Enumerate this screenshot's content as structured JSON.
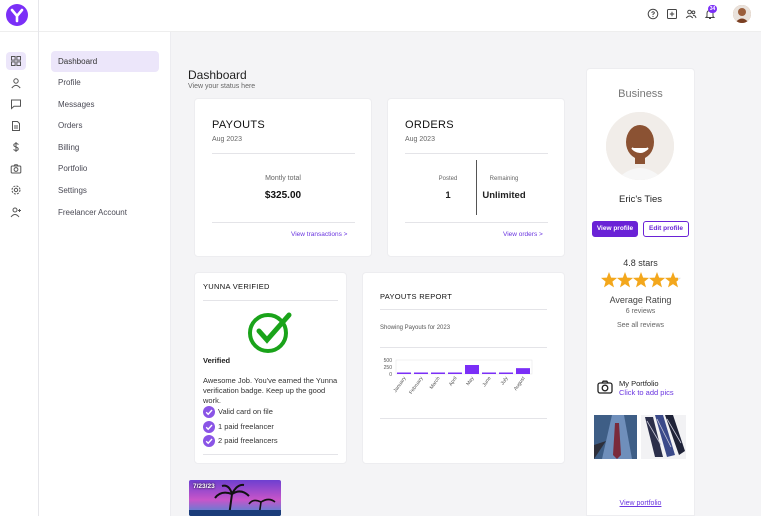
{
  "topbar": {
    "icons": [
      "help-icon",
      "add-box-icon",
      "people-icon",
      "bell-icon"
    ],
    "notification_count": "34"
  },
  "rail": {
    "icons": [
      "dashboard-icon",
      "profile-icon",
      "messages-icon",
      "orders-icon",
      "billing-icon",
      "portfolio-icon",
      "settings-icon",
      "add-user-icon"
    ]
  },
  "sidebar": {
    "items": [
      {
        "label": "Dashboard"
      },
      {
        "label": "Profile"
      },
      {
        "label": "Messages"
      },
      {
        "label": "Orders"
      },
      {
        "label": "Billing"
      },
      {
        "label": "Portfolio"
      },
      {
        "label": "Settings"
      },
      {
        "label": "Freelancer Account"
      }
    ]
  },
  "main": {
    "title": "Dashboard",
    "subtitle": "View your status here"
  },
  "payouts": {
    "title": "PAYOUTS",
    "period": "Aug 2023",
    "total_label": "Montly total",
    "total_value": "$325.00",
    "link": "View transactions >"
  },
  "orders": {
    "title": "ORDERS",
    "period": "Aug 2023",
    "posted_label": "Posted",
    "posted_value": "1",
    "remaining_label": "Remaining",
    "remaining_value": "Unlimited",
    "link": "View orders >"
  },
  "verified": {
    "title": "YUNNA VERIFIED",
    "status": "Verified",
    "message": "Awesome Job. You've earned the Yunna verification badge. Keep up the good work.",
    "items": [
      "Valid card on file",
      "1 paid freelancer",
      "2 paid freelancers"
    ]
  },
  "report": {
    "title": "PAYOUTS REPORT",
    "caption": "Showing Payouts for 2023"
  },
  "chart_data": {
    "type": "bar",
    "categories": [
      "January",
      "February",
      "March",
      "April",
      "May",
      "June",
      "July",
      "August"
    ],
    "values": [
      10,
      10,
      10,
      10,
      500,
      10,
      10,
      325
    ],
    "yticks": [
      "500",
      "250",
      "0"
    ],
    "ylim": [
      0,
      500
    ],
    "bar_color": "#7b2ff7"
  },
  "thumb": {
    "date": "7/23/23"
  },
  "profile": {
    "heading": "Business",
    "name": "Eric's Ties",
    "view_btn": "View profile",
    "edit_btn": "Edit profile",
    "stars_text": "4.8 stars",
    "rating": 4.8,
    "rating_label": "Average Rating",
    "reviews": "6 reviews",
    "see_all": "See all reviews",
    "portfolio_title": "My Portfolio",
    "portfolio_sub": "Click to add pics",
    "view_portfolio": "View portfolio"
  },
  "colors": {
    "accent": "#7b2ff7",
    "check_green": "#1aa31a"
  }
}
